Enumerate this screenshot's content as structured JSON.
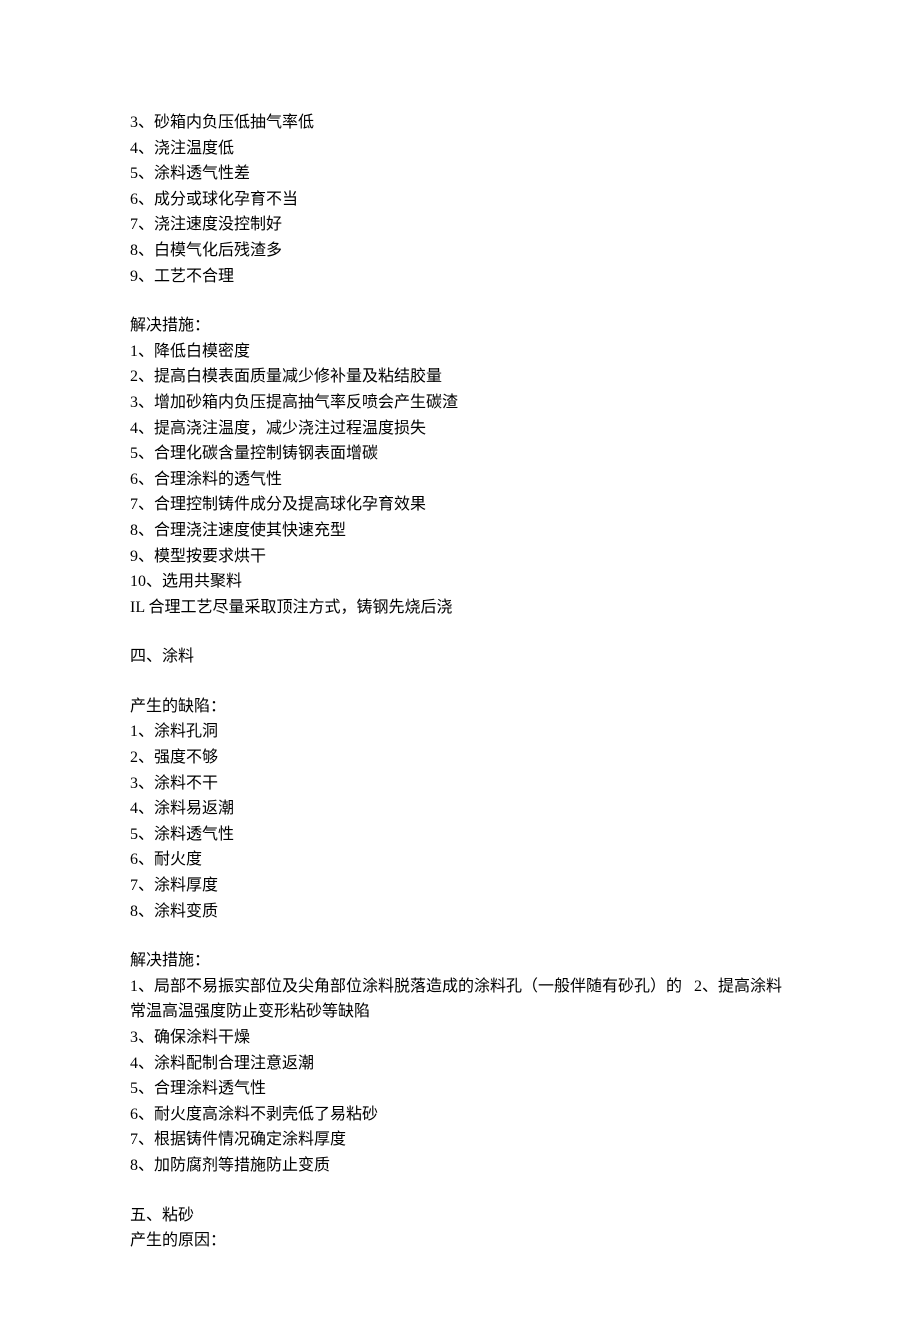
{
  "block1": {
    "items": [
      "3、砂箱内负压低抽气率低",
      "4、浇注温度低",
      "5、涂料透气性差",
      "6、成分或球化孕育不当",
      "7、浇注速度没控制好",
      "8、白模气化后残渣多",
      "9、工艺不合理"
    ]
  },
  "block2": {
    "heading": "解决措施：",
    "items": [
      "1、降低白模密度",
      "2、提高白模表面质量减少修补量及粘结胶量",
      "3、增加砂箱内负压提高抽气率反喷会产生碳渣",
      "4、提高浇注温度，减少浇注过程温度损失",
      "5、合理化碳含量控制铸钢表面增碳",
      "6、合理涂料的透气性",
      "7、合理控制铸件成分及提高球化孕育效果",
      "8、合理浇注速度使其快速充型",
      "9、模型按要求烘干",
      "10、选用共聚料",
      "IL 合理工艺尽量采取顶注方式，铸钢先烧后浇"
    ]
  },
  "block3": {
    "heading": "四、涂料"
  },
  "block4": {
    "heading": "产生的缺陷：",
    "items": [
      "1、涂料孔洞",
      "2、强度不够",
      "3、涂料不干",
      "4、涂料易返潮",
      "5、涂料透气性",
      "6、耐火度",
      "7、涂料厚度",
      "8、涂料变质"
    ]
  },
  "block5": {
    "heading": "解决措施：",
    "line1_part1": "1、局部不易振实部位及尖角部位涂料脱落造成的涂料孔（一般伴随有砂孔）的",
    "line1_part2": "2、提高涂料",
    "line2": "常温高温强度防止变形粘砂等缺陷",
    "items": [
      "3、确保涂料干燥",
      "4、涂料配制合理注意返潮",
      "5、合理涂料透气性",
      "6、耐火度高涂料不剥壳低了易粘砂",
      "7、根据铸件情况确定涂料厚度",
      "8、加防腐剂等措施防止变质"
    ]
  },
  "block6": {
    "heading1": "五、粘砂",
    "heading2": "产生的原因："
  }
}
